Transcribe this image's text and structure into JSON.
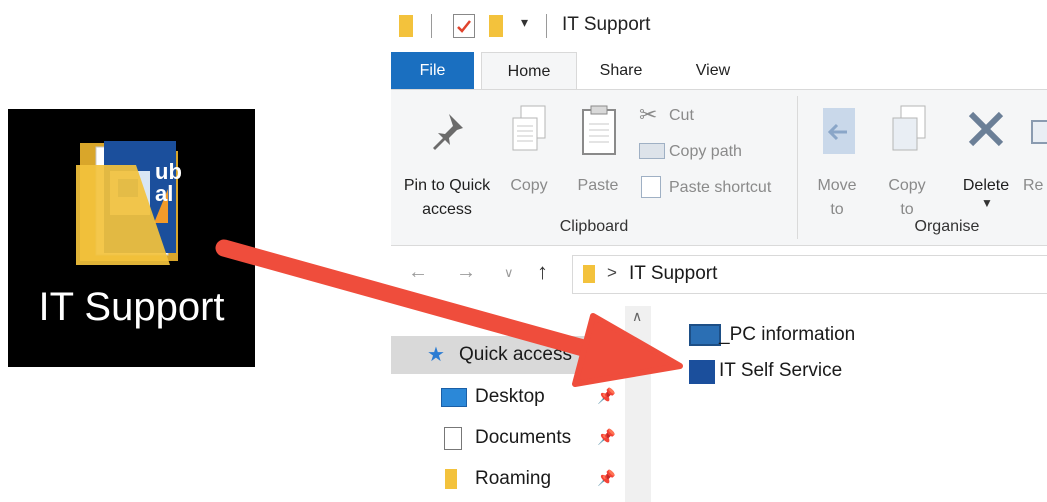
{
  "desktop_icon": {
    "label": "IT Support",
    "icon": "folder-icon",
    "badge_text": "ub\nal"
  },
  "window": {
    "title": "IT Support",
    "quick_access_toolbar": [
      "folder-icon",
      "properties-icon",
      "new-folder-icon",
      "customize-toolbar-icon"
    ],
    "tabs": [
      "File",
      "Home",
      "Share",
      "View"
    ],
    "active_tab": "Home",
    "ribbon": {
      "clipboard": {
        "group_label": "Clipboard",
        "pin_label_line1": "Pin to Quick",
        "pin_label_line2": "access",
        "copy_label": "Copy",
        "paste_label": "Paste",
        "cut_label": "Cut",
        "copy_path_label": "Copy path",
        "paste_shortcut_label": "Paste shortcut"
      },
      "organise": {
        "group_label": "Organise",
        "move_to_line1": "Move",
        "move_to_line2": "to",
        "copy_to_line1": "Copy",
        "copy_to_line2": "to",
        "delete_label": "Delete",
        "rename_label": "Re"
      }
    },
    "address": {
      "breadcrumb": "IT Support",
      "separator": ">"
    },
    "navigation_pane": [
      {
        "label": "Quick access",
        "icon": "star-icon",
        "selected": true
      },
      {
        "label": "Desktop",
        "icon": "desktop-icon",
        "pinned": true
      },
      {
        "label": "Documents",
        "icon": "documents-icon",
        "pinned": true
      },
      {
        "label": "Roaming",
        "icon": "folder-icon",
        "pinned": true
      }
    ],
    "files": [
      {
        "label": "_PC information",
        "icon": "monitor-icon"
      },
      {
        "label": "IT Self Service",
        "icon": "app-icon"
      }
    ]
  },
  "colors": {
    "accent": "#1a6fc0",
    "arrow": "#ef4d3c",
    "folder": "#f3c23c"
  }
}
